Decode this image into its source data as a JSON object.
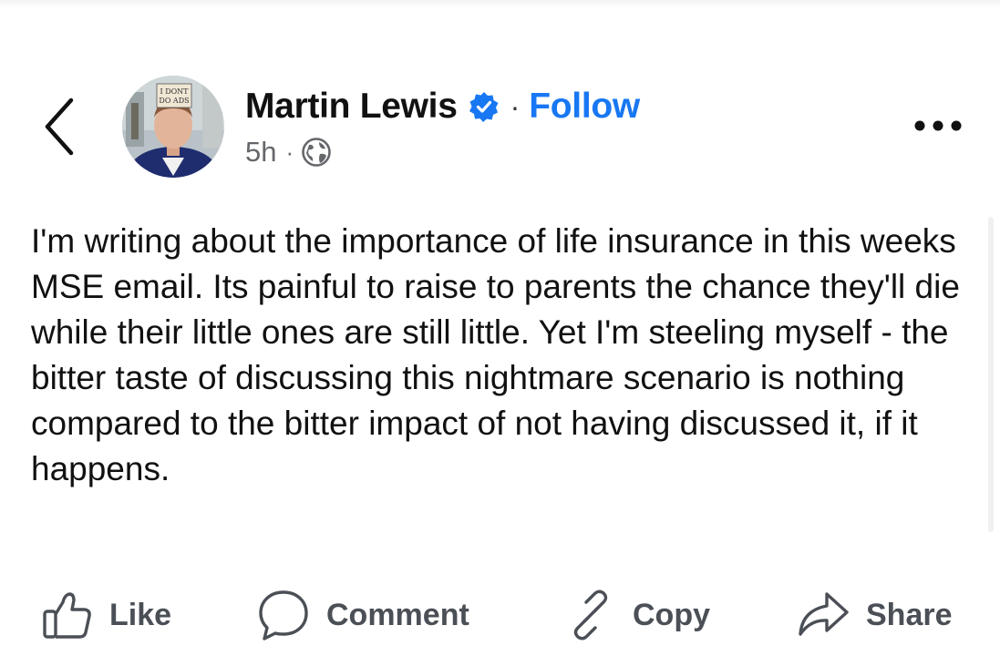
{
  "header": {
    "author_name": "Martin Lewis",
    "separator": "·",
    "follow_label": "Follow",
    "timestamp": "5h",
    "meta_separator": "·",
    "audience_icon": "globe-icon",
    "verified_icon": "verified-badge-icon",
    "more_icon": "more-options-icon",
    "back_icon": "chevron-left-icon",
    "avatar_sign_text": "I DONT DO ADS"
  },
  "post": {
    "text": "I'm writing about the importance of life insurance in this weeks MSE email.  Its painful to raise to parents the chance they'll die while their little ones are still little. Yet I'm steeling myself - the bitter taste of discussing this nightmare scenario is nothing compared to the bitter impact of not having discussed it, if it happens."
  },
  "actions": {
    "like": {
      "label": "Like",
      "icon": "thumbs-up-icon"
    },
    "comment": {
      "label": "Comment",
      "icon": "comment-bubble-icon"
    },
    "copy": {
      "label": "Copy",
      "icon": "link-icon"
    },
    "share": {
      "label": "Share",
      "icon": "share-arrow-icon"
    }
  },
  "colors": {
    "accent": "#1877f2",
    "text": "#111111",
    "secondary_text": "#65676b",
    "action_text": "#4b4f56"
  }
}
